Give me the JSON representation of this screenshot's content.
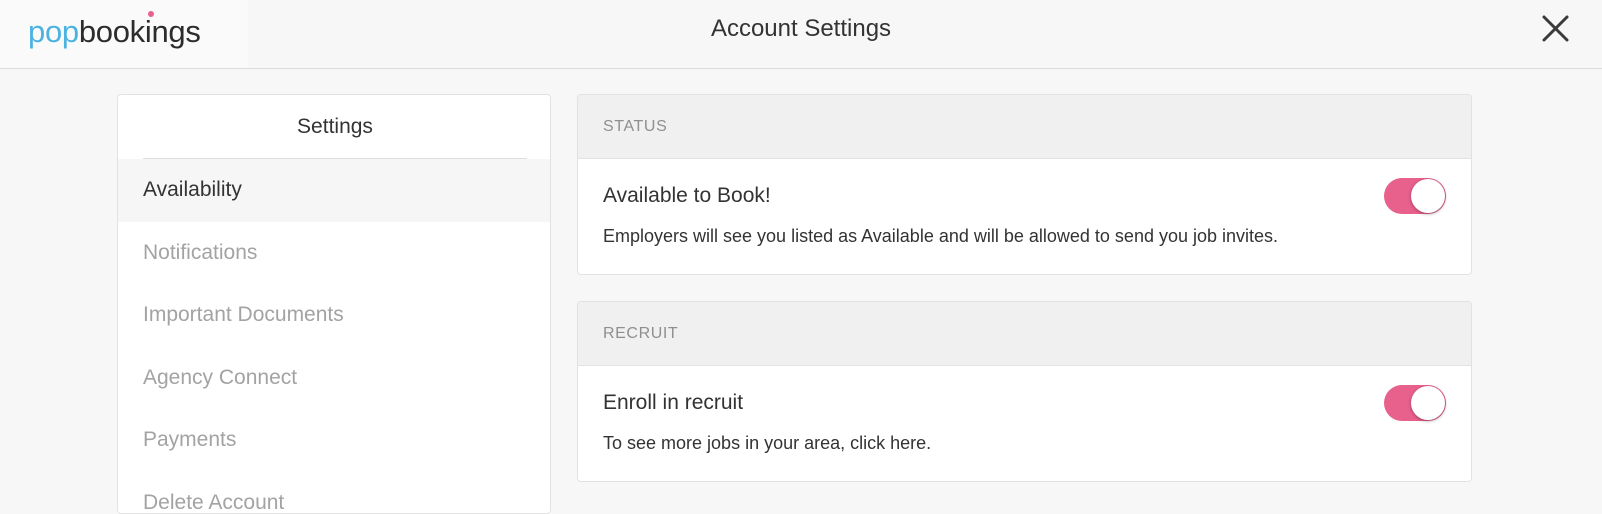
{
  "app": {
    "logo": {
      "part1": "pop",
      "part2": "bookings"
    },
    "title": "Account Settings"
  },
  "sidebar": {
    "heading": "Settings",
    "items": [
      {
        "label": "Availability",
        "active": true
      },
      {
        "label": "Notifications",
        "active": false
      },
      {
        "label": "Important Documents",
        "active": false
      },
      {
        "label": "Agency Connect",
        "active": false
      },
      {
        "label": "Payments",
        "active": false
      },
      {
        "label": "Delete Account",
        "active": false
      }
    ]
  },
  "sections": {
    "status": {
      "header": "STATUS",
      "title": "Available to Book!",
      "description": "Employers will see you listed as Available and will be allowed to send you job invites.",
      "toggle_on": true
    },
    "recruit": {
      "header": "RECRUIT",
      "title": "Enroll in recruit",
      "description": "To see more jobs in your area, click here.",
      "toggle_on": true
    }
  },
  "icons": {
    "close": "close-icon"
  },
  "colors": {
    "brand_blue": "#4cb3e0",
    "accent_pink": "#e8608c",
    "text_dark": "#333333",
    "text_muted": "#a3a3a3"
  }
}
